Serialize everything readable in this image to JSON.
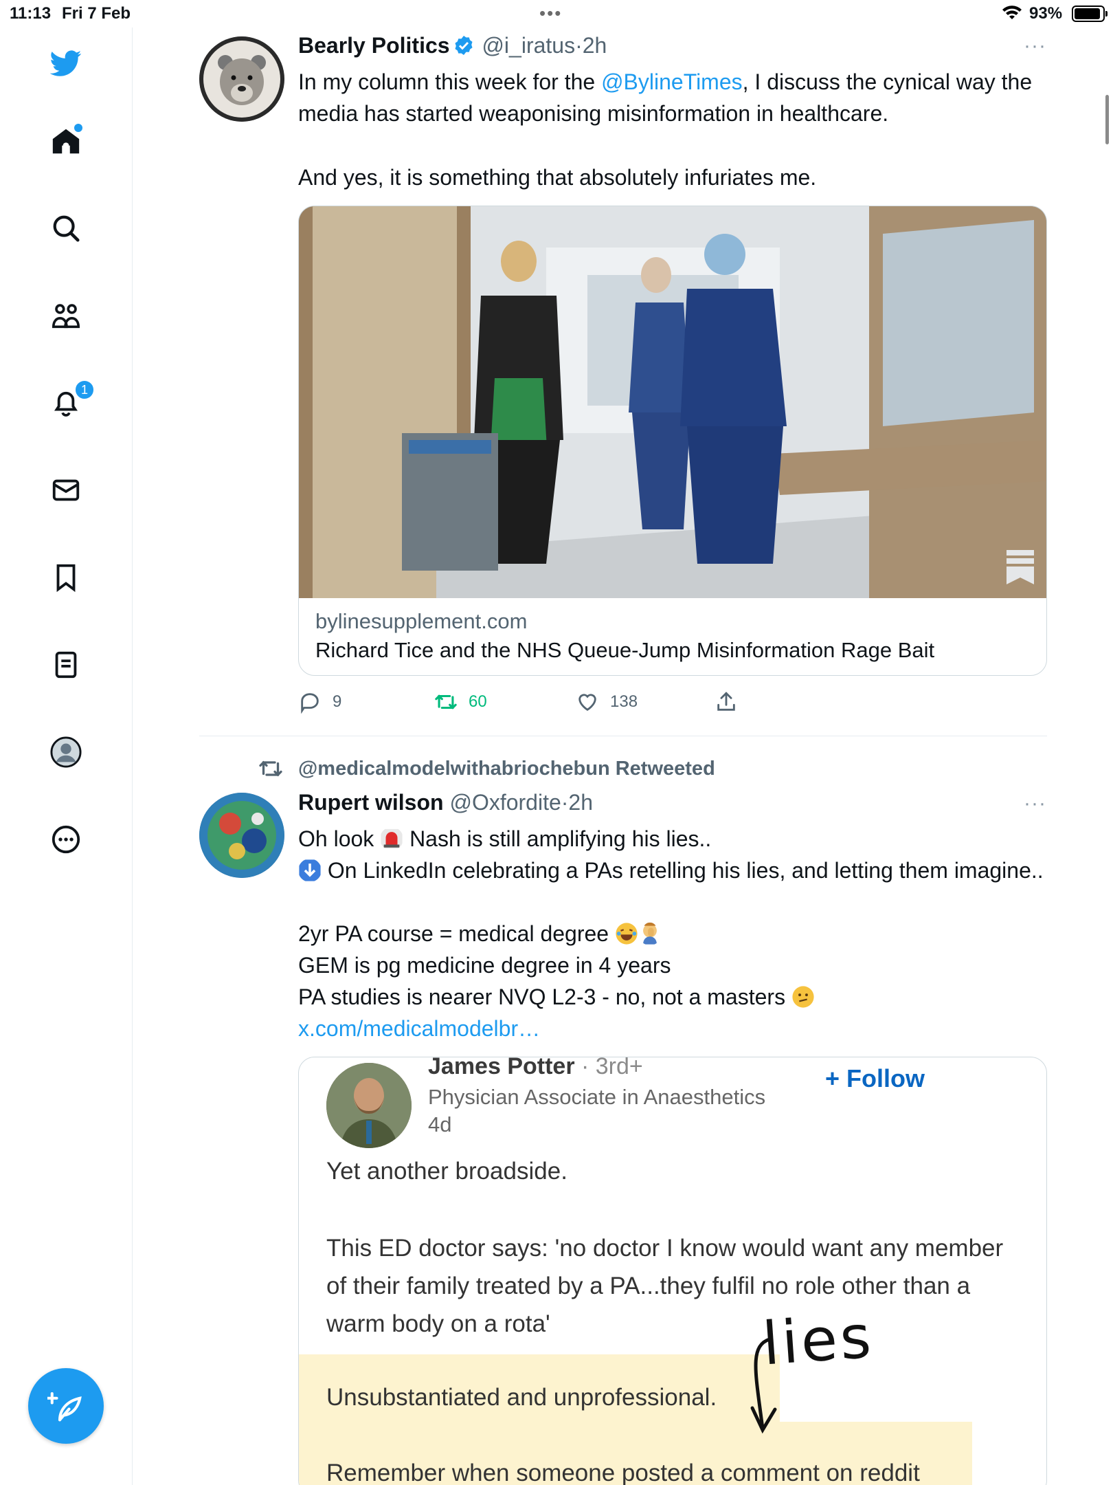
{
  "status_bar": {
    "time": "11:13",
    "date": "Fri 7 Feb",
    "battery_pct": "93%",
    "battery_level": 0.93
  },
  "sidebar": {
    "notifications_badge": "1",
    "items": [
      "twitter-logo",
      "home",
      "explore",
      "communities",
      "notifications",
      "messages",
      "bookmarks",
      "lists",
      "profile",
      "more"
    ]
  },
  "colors": {
    "accent": "#1d9bf0",
    "retweet_green": "#00ba7c",
    "secondary": "#536471"
  },
  "tweet1": {
    "name": "Bearly Politics",
    "handle": "@i_iratus",
    "sep": "·",
    "time": "2h",
    "more": "···",
    "text_before_link": "In my column this week for the ",
    "mention": "@BylineTimes",
    "text_after_link": ", I discuss the cynical way the media has started weaponising misinformation in healthcare.",
    "text_2": "And yes, it is something that absolutely infuriates me.",
    "card": {
      "domain": "bylinesupplement.com",
      "title": "Richard Tice and the NHS Queue-Jump Misinformation Rage Bait"
    },
    "actions": {
      "replies": "9",
      "retweets": "60",
      "likes": "138"
    }
  },
  "tweet2": {
    "retweeted_by": "@medicalmodelwithabriochebun Retweeted",
    "name": "Rupert wilson",
    "handle": "@Oxfordite",
    "sep": "·",
    "time": "2h",
    "more": "···",
    "line1a": "Oh look ",
    "line1b": " Nash is still amplifying his lies..",
    "line2": " On LinkedIn celebrating a PAs retelling his lies, and letting them imagine..",
    "line3": "2yr PA course = medical degree ",
    "line4": "GEM is pg medicine degree in 4 years",
    "line5": "PA studies is nearer NVQ L2-3 - no, not a masters ",
    "link": "x.com/medicalmodelbr…",
    "quote": {
      "name": "James Potter",
      "degree": " · 3rd+",
      "role": "Physician Associate in Anaesthetics",
      "ago": "4d",
      "follow": "+ Follow",
      "p1": "Yet another broadside.",
      "p2": "This ED doctor says: 'no doctor I know would want any member of their family treated by a PA...they fulfil no role other than a warm body on a rota'",
      "p3": "Unsubstantiated and unprofessional.",
      "p4": "Remember when someone posted a comment on reddit",
      "annotation": "lies"
    }
  }
}
